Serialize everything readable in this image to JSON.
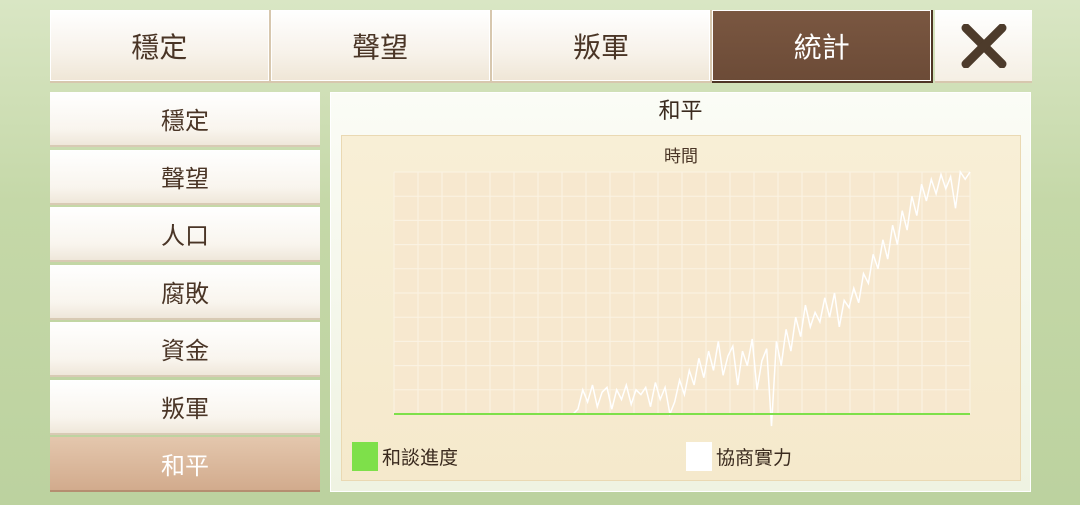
{
  "tabs": [
    {
      "label": "穩定",
      "active": false
    },
    {
      "label": "聲望",
      "active": false
    },
    {
      "label": "叛軍",
      "active": false
    },
    {
      "label": "統計",
      "active": true
    }
  ],
  "close_icon": "close-x-icon",
  "sidebar": {
    "items": [
      {
        "label": "穩定",
        "active": false
      },
      {
        "label": "聲望",
        "active": false
      },
      {
        "label": "人口",
        "active": false
      },
      {
        "label": "腐敗",
        "active": false
      },
      {
        "label": "資金",
        "active": false
      },
      {
        "label": "叛軍",
        "active": false
      },
      {
        "label": "和平",
        "active": true
      }
    ]
  },
  "panel": {
    "title": "和平"
  },
  "chart_data": {
    "type": "line",
    "title": "時間",
    "xlabel": "",
    "ylabel": "",
    "grid": true,
    "legend_position": "bottom",
    "ylim": [
      0,
      1
    ],
    "series": [
      {
        "name": "和談進度",
        "color": "#7ee04a",
        "values": [
          0,
          0,
          0,
          0,
          0,
          0,
          0,
          0,
          0,
          0,
          0,
          0,
          0,
          0,
          0,
          0,
          0,
          0,
          0,
          0,
          0,
          0,
          0,
          0,
          0,
          0,
          0,
          0,
          0,
          0,
          0,
          0,
          0,
          0,
          0,
          0,
          0,
          0,
          0,
          0,
          0,
          0,
          0,
          0,
          0,
          0,
          0,
          0,
          0,
          0,
          0,
          0,
          0,
          0,
          0,
          0,
          0,
          0,
          0,
          0,
          0,
          0,
          0,
          0,
          0,
          0,
          0,
          0,
          0,
          0,
          0,
          0,
          0,
          0,
          0,
          0,
          0,
          0,
          0,
          0,
          0,
          0,
          0,
          0,
          0,
          0,
          0,
          0,
          0,
          0,
          0,
          0,
          0,
          0,
          0,
          0,
          0,
          0,
          0,
          0,
          0,
          0,
          0,
          0,
          0,
          0,
          0,
          0,
          0,
          0,
          0,
          0,
          0,
          0,
          0,
          0,
          0,
          0,
          0,
          0
        ]
      },
      {
        "name": "協商實力",
        "color": "#ffffff",
        "values": [
          0,
          0,
          0,
          0,
          0,
          0,
          0,
          0,
          0,
          0,
          0,
          0,
          0,
          0,
          0,
          0,
          0,
          0,
          0,
          0,
          0,
          0,
          0,
          0,
          0,
          0,
          0,
          0,
          0,
          0,
          0,
          0,
          0,
          0,
          0,
          0,
          0,
          0,
          0.02,
          0.1,
          0.05,
          0.12,
          0.03,
          0.09,
          0.11,
          0.02,
          0.1,
          0.06,
          0.12,
          0.04,
          0.1,
          0.08,
          0.11,
          0.03,
          0.13,
          0.06,
          0.11,
          0.0,
          0.05,
          0.14,
          0.08,
          0.18,
          0.12,
          0.23,
          0.15,
          0.26,
          0.18,
          0.3,
          0.16,
          0.24,
          0.28,
          0.12,
          0.26,
          0.2,
          0.31,
          0.1,
          0.22,
          0.27,
          -0.05,
          0.3,
          0.2,
          0.35,
          0.26,
          0.4,
          0.32,
          0.45,
          0.36,
          0.42,
          0.38,
          0.48,
          0.4,
          0.5,
          0.36,
          0.47,
          0.44,
          0.52,
          0.46,
          0.58,
          0.54,
          0.66,
          0.6,
          0.72,
          0.64,
          0.78,
          0.7,
          0.84,
          0.76,
          0.9,
          0.82,
          0.95,
          0.88,
          0.97,
          0.91,
          0.99,
          0.93,
          0.98,
          0.85,
          1.0,
          0.97,
          1.0
        ]
      }
    ]
  }
}
